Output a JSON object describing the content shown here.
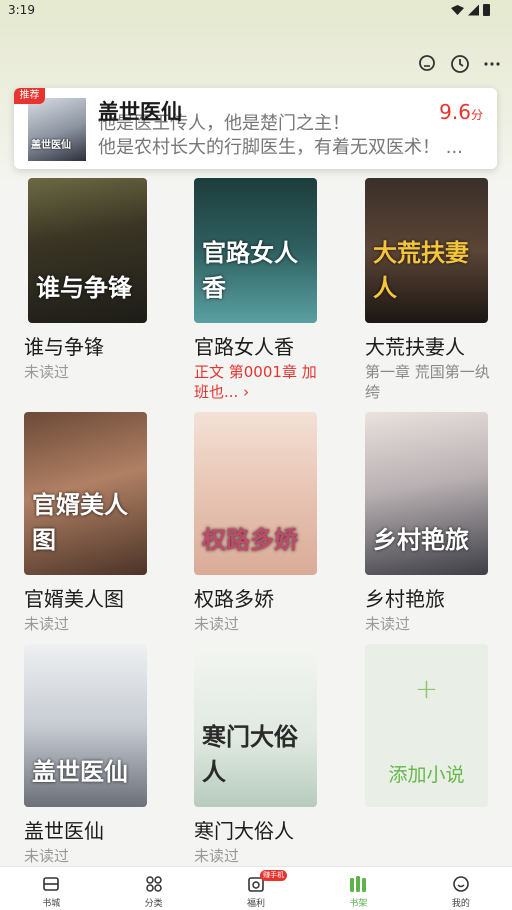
{
  "status_bar": {
    "time": "3:19"
  },
  "recommend": {
    "badge": "推荐",
    "title": "盖世医仙",
    "desc_line1": "他是医王传人，他是楚门之主！",
    "desc_line2": "他是农村长大的行脚医生，有着无双医术！ ...",
    "score": "9.6",
    "score_unit": "分",
    "cover_text": "盖世医仙"
  },
  "books": [
    {
      "title": "谁与争锋",
      "status": "未读过",
      "cover_text": "谁与争锋"
    },
    {
      "title": "官路女人香",
      "status": "正文 第0001章 加班也... ›",
      "cover_text": "官路女人香"
    },
    {
      "title": "大荒扶妻人",
      "status": "第一章 荒国第一纨绔",
      "cover_text": "大荒扶妻人"
    },
    {
      "title": "官婿美人图",
      "status": "未读过",
      "cover_text": "官婿美人图"
    },
    {
      "title": "权路多娇",
      "status": "未读过",
      "cover_text": "权路多娇"
    },
    {
      "title": "乡村艳旅",
      "status": "未读过",
      "cover_text": "乡村艳旅"
    },
    {
      "title": "盖世医仙",
      "status": "未读过",
      "cover_text": "盖世医仙"
    },
    {
      "title": "寒门大俗人",
      "status": "未读过",
      "cover_text": "寒门大俗人"
    }
  ],
  "add_card": {
    "plus": "+",
    "label": "添加小说"
  },
  "nav": {
    "items": [
      {
        "label": "书城",
        "icon": "bookstore-icon"
      },
      {
        "label": "分类",
        "icon": "category-icon"
      },
      {
        "label": "福利",
        "icon": "welfare-icon",
        "badge": "赚手机"
      },
      {
        "label": "书架",
        "icon": "bookshelf-icon"
      },
      {
        "label": "我的",
        "icon": "profile-icon"
      }
    ],
    "active": "书架"
  },
  "colors": {
    "accent_red": "#e8342e",
    "accent_green": "#5cb34a"
  }
}
